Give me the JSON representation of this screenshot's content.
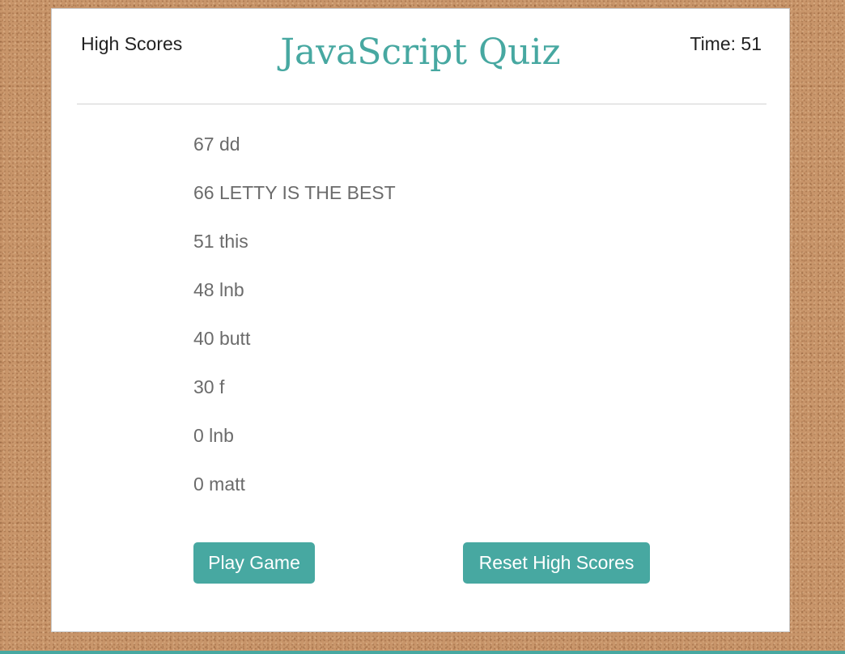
{
  "header": {
    "high_scores_link": "High Scores",
    "title": "JavaScript Quiz",
    "timer": "Time: 51"
  },
  "scores": [
    "67 dd",
    "66 LETTY IS THE BEST",
    "51 this",
    "48 lnb",
    "40 butt",
    "30 f",
    "0 lnb",
    "0 matt"
  ],
  "buttons": {
    "play": "Play Game",
    "reset": "Reset High Scores"
  },
  "colors": {
    "accent": "#47a8a1",
    "background": "#c8956a"
  }
}
